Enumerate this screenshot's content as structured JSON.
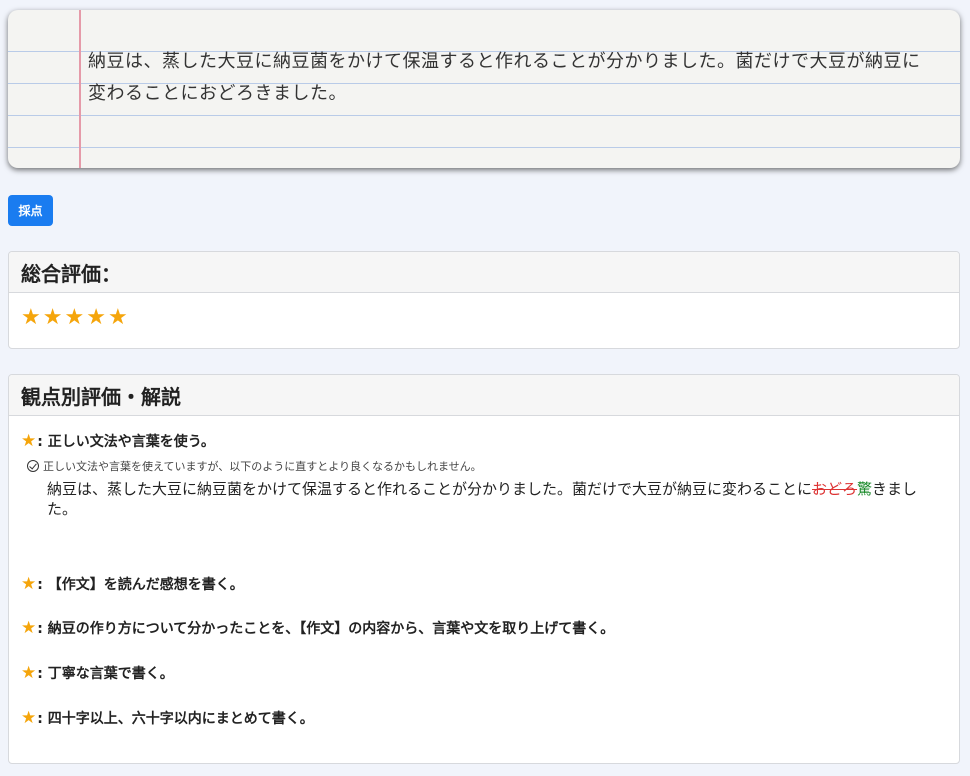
{
  "notebook": {
    "text": "納豆は、蒸した大豆に納豆菌をかけて保温すると作れることが分かりました。菌だけで大豆が納豆に変わることにおどろきました。"
  },
  "score_button": {
    "label": "採点"
  },
  "overall": {
    "title": "総合評価：",
    "rating": 5,
    "max_rating": 5
  },
  "detail": {
    "title": "観点別評価・解説",
    "criteria": [
      {
        "label": ": 正しい文法や言葉を使う。"
      },
      {
        "label": ": 【作文】を読んだ感想を書く。"
      },
      {
        "label": ": 納豆の作り方について分かったことを、【作文】の内容から、言葉や文を取り上げて書く。"
      },
      {
        "label": ": 丁寧な言葉で書く。"
      },
      {
        "label": ": 四十字以上、六十字以内にまとめて書く。"
      }
    ],
    "hint": "正しい文法や言葉を使えていますが、以下のように直すとより良くなるかもしれません。",
    "corrected": {
      "before": "納豆は、蒸した大豆に納豆菌をかけて保温すると作れることが分かりました。菌だけで大豆が納豆に変わることに",
      "deleted": "おどろ",
      "inserted": "驚",
      "after": "きました。"
    }
  },
  "colors": {
    "accent": "#1a7cf0",
    "star": "#f5a50b",
    "deleted": "#dd3333",
    "inserted": "#1a8a2a"
  }
}
